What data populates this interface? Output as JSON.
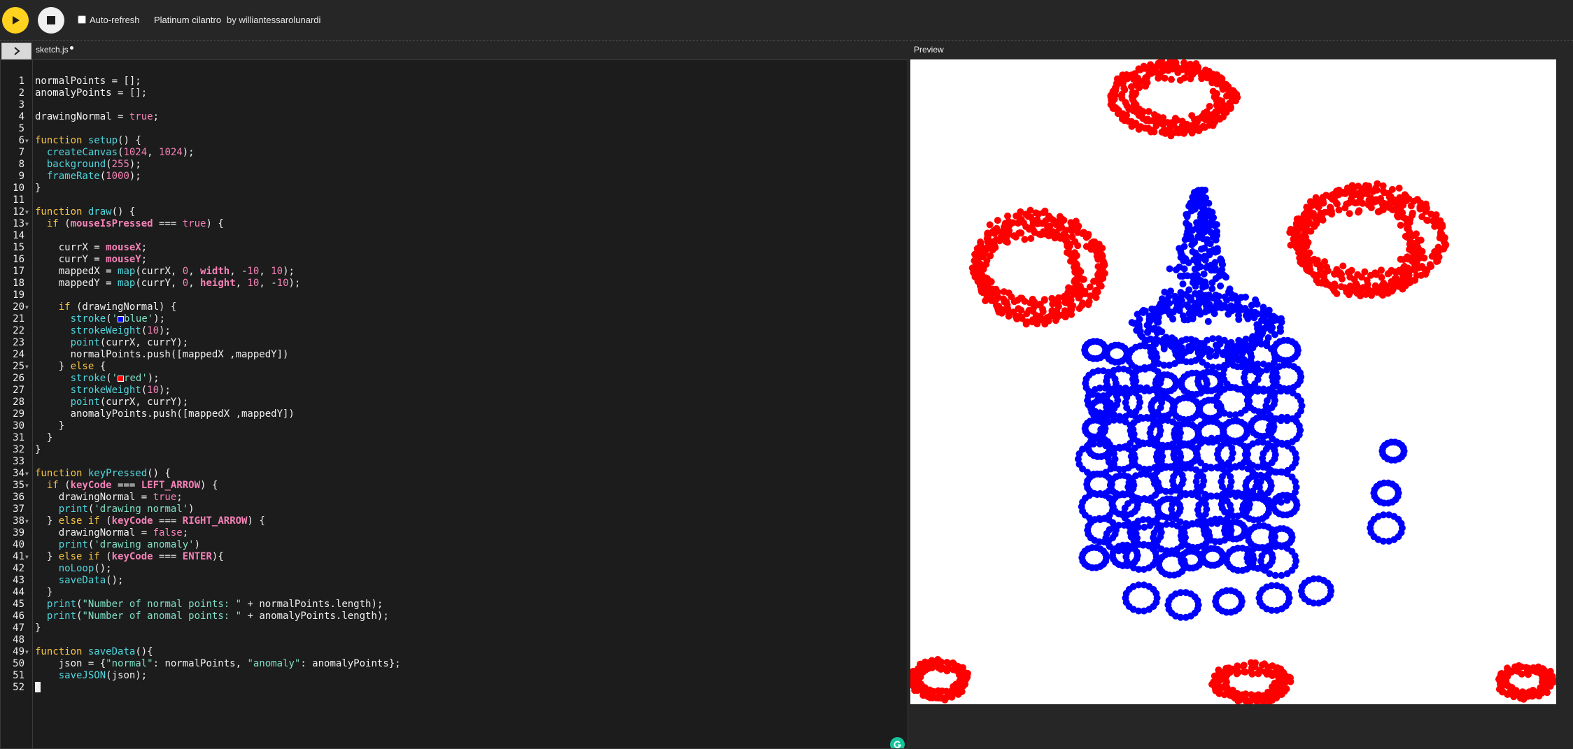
{
  "toolbar": {
    "auto_refresh_label": "Auto-refresh",
    "auto_refresh_checked": false,
    "sketch_title": "Platinum cilantro",
    "sketch_author": "by williantessarolunardi"
  },
  "editor": {
    "file_tab": "sketch.js",
    "unsaved": true
  },
  "preview": {
    "label": "Preview"
  },
  "colors": {
    "play_button": "#ffd21f",
    "normal_points": "#0000ff",
    "anomaly_points": "#ff0000",
    "editor_bg": "#1c1c1c",
    "grammarly": "#15c39a"
  },
  "icons": {
    "play": "play-icon",
    "stop": "stop-icon",
    "sidebar_toggle": "chevron-right-icon",
    "grammarly": "grammarly-icon"
  },
  "code_lines": [
    "normalPoints = [];",
    "anomalyPoints = [];",
    "",
    "drawingNormal = true;",
    "",
    "function setup() {",
    "  createCanvas(1024, 1024);",
    "  background(255);",
    "  frameRate(1000);",
    "}",
    "",
    "function draw() {",
    "  if (mouseIsPressed === true) {",
    "",
    "    currX = mouseX;",
    "    currY = mouseY;",
    "    mappedX = map(currX, 0, width, -10, 10);",
    "    mappedY = map(currY, 0, height, 10, -10);",
    "",
    "    if (drawingNormal) {",
    "      stroke('blue');",
    "      strokeWeight(10);",
    "      point(currX, currY);",
    "      normalPoints.push([mappedX ,mappedY])",
    "    } else {",
    "      stroke('red');",
    "      strokeWeight(10);",
    "      point(currX, currY);",
    "      anomalyPoints.push([mappedX ,mappedY])",
    "    }",
    "  }",
    "}",
    "",
    "function keyPressed() {",
    "  if (keyCode === LEFT_ARROW) {",
    "    drawingNormal = true;",
    "    print('drawing normal')",
    "  } else if (keyCode === RIGHT_ARROW) {",
    "    drawingNormal = false;",
    "    print('drawing anomaly')",
    "  } else if (keyCode === ENTER){",
    "    noLoop();",
    "    saveData();",
    "  }",
    "  print(\"Number of normal points: \" + normalPoints.length);",
    "  print(\"Number of anomal points: \" + anomalyPoints.length);",
    "}",
    "",
    "function saveData(){",
    "    json = {\"normal\": normalPoints, \"anomaly\": anomalyPoints};",
    "    saveJSON(json);",
    ""
  ]
}
